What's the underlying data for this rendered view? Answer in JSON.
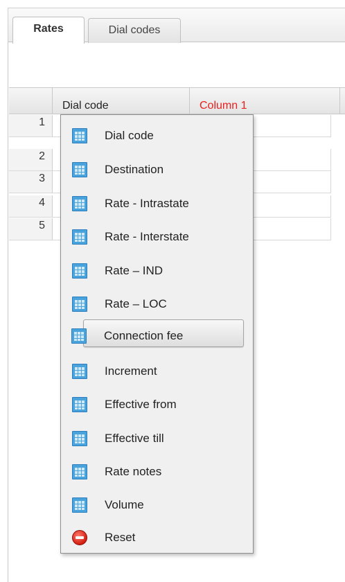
{
  "tabs": [
    {
      "label": "Rates",
      "active": true
    },
    {
      "label": "Dial codes",
      "active": false
    }
  ],
  "grid": {
    "columns": [
      "Dial code",
      "Column 1"
    ],
    "row_numbers": [
      "1",
      "2",
      "3",
      "4",
      "5"
    ]
  },
  "context_menu": {
    "items": [
      {
        "label": "Dial code",
        "icon": "table-icon"
      },
      {
        "label": "Destination",
        "icon": "table-icon"
      },
      {
        "label": "Rate - Intrastate",
        "icon": "table-icon"
      },
      {
        "label": "Rate - Interstate",
        "icon": "table-icon"
      },
      {
        "label": "Rate – IND",
        "icon": "table-icon"
      },
      {
        "label": "Rate – LOC",
        "icon": "table-icon"
      },
      {
        "label": "Connection fee",
        "icon": "table-icon",
        "hovered": true
      },
      {
        "label": "Increment",
        "icon": "table-icon"
      },
      {
        "label": "Effective from",
        "icon": "table-icon"
      },
      {
        "label": "Effective till",
        "icon": "table-icon"
      },
      {
        "label": "Rate notes",
        "icon": "table-icon"
      },
      {
        "label": "Volume",
        "icon": "table-icon"
      },
      {
        "label": "Reset",
        "icon": "reset-icon"
      }
    ]
  },
  "colors": {
    "highlight_column_text": "#e8201f",
    "icon_blue": "#4ba3dc",
    "reset_red": "#d41e12"
  }
}
